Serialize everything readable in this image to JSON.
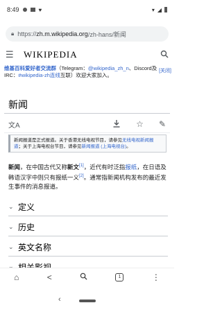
{
  "status": {
    "time": "8:49"
  },
  "browser": {
    "url_prefix": "https://",
    "url_host": "zh.m.wikipedia.org",
    "url_path": "/zh-hans/新闻"
  },
  "site": {
    "wordmark": "WIKIPEDIA"
  },
  "banner": {
    "bold": "维基百科爱好者交流群",
    "t1": "（Telegram：",
    "l1": "@wikipedia_zh_n",
    "t2": "、Discord",
    "t3": "及IRC：",
    "l2": "#wikipedia-zh",
    "t4": "连线",
    "t5": "互联）欢迎大家加入。",
    "side_label": "[关闭]"
  },
  "article": {
    "title": "新闻",
    "notice_t1": "新闻报道是正式报道。关于香港无线电视节目，请参见",
    "notice_l1": "无线电视新闻报道",
    "notice_t2": "；关于上海电视台节目，请参见",
    "notice_l2": "新闻报道 (上海电视台)",
    "notice_t3": "。",
    "p_bold1": "新闻",
    "p_t1": "，在中国古代又称",
    "p_bold2": "新文",
    "p_ref1": "[1]",
    "p_t2": "，近代有时泛指",
    "p_l1": "报纸",
    "p_t3": "，在日语及韩语汉字中则只有报纸一义",
    "p_ref2": "[2]",
    "p_t4": "。通常指新闻机构发布的最近发生事件的消息报道。"
  },
  "sections": [
    "定义",
    "历史",
    "英文名称",
    "相关影视"
  ],
  "tabs": {
    "count": "1"
  },
  "icons": {
    "lock": "lock-icon",
    "menu": "hamburger-icon",
    "search": "search-icon",
    "language": "language-icon",
    "download": "download-icon",
    "watch": "star-icon",
    "edit": "pencil-icon"
  }
}
